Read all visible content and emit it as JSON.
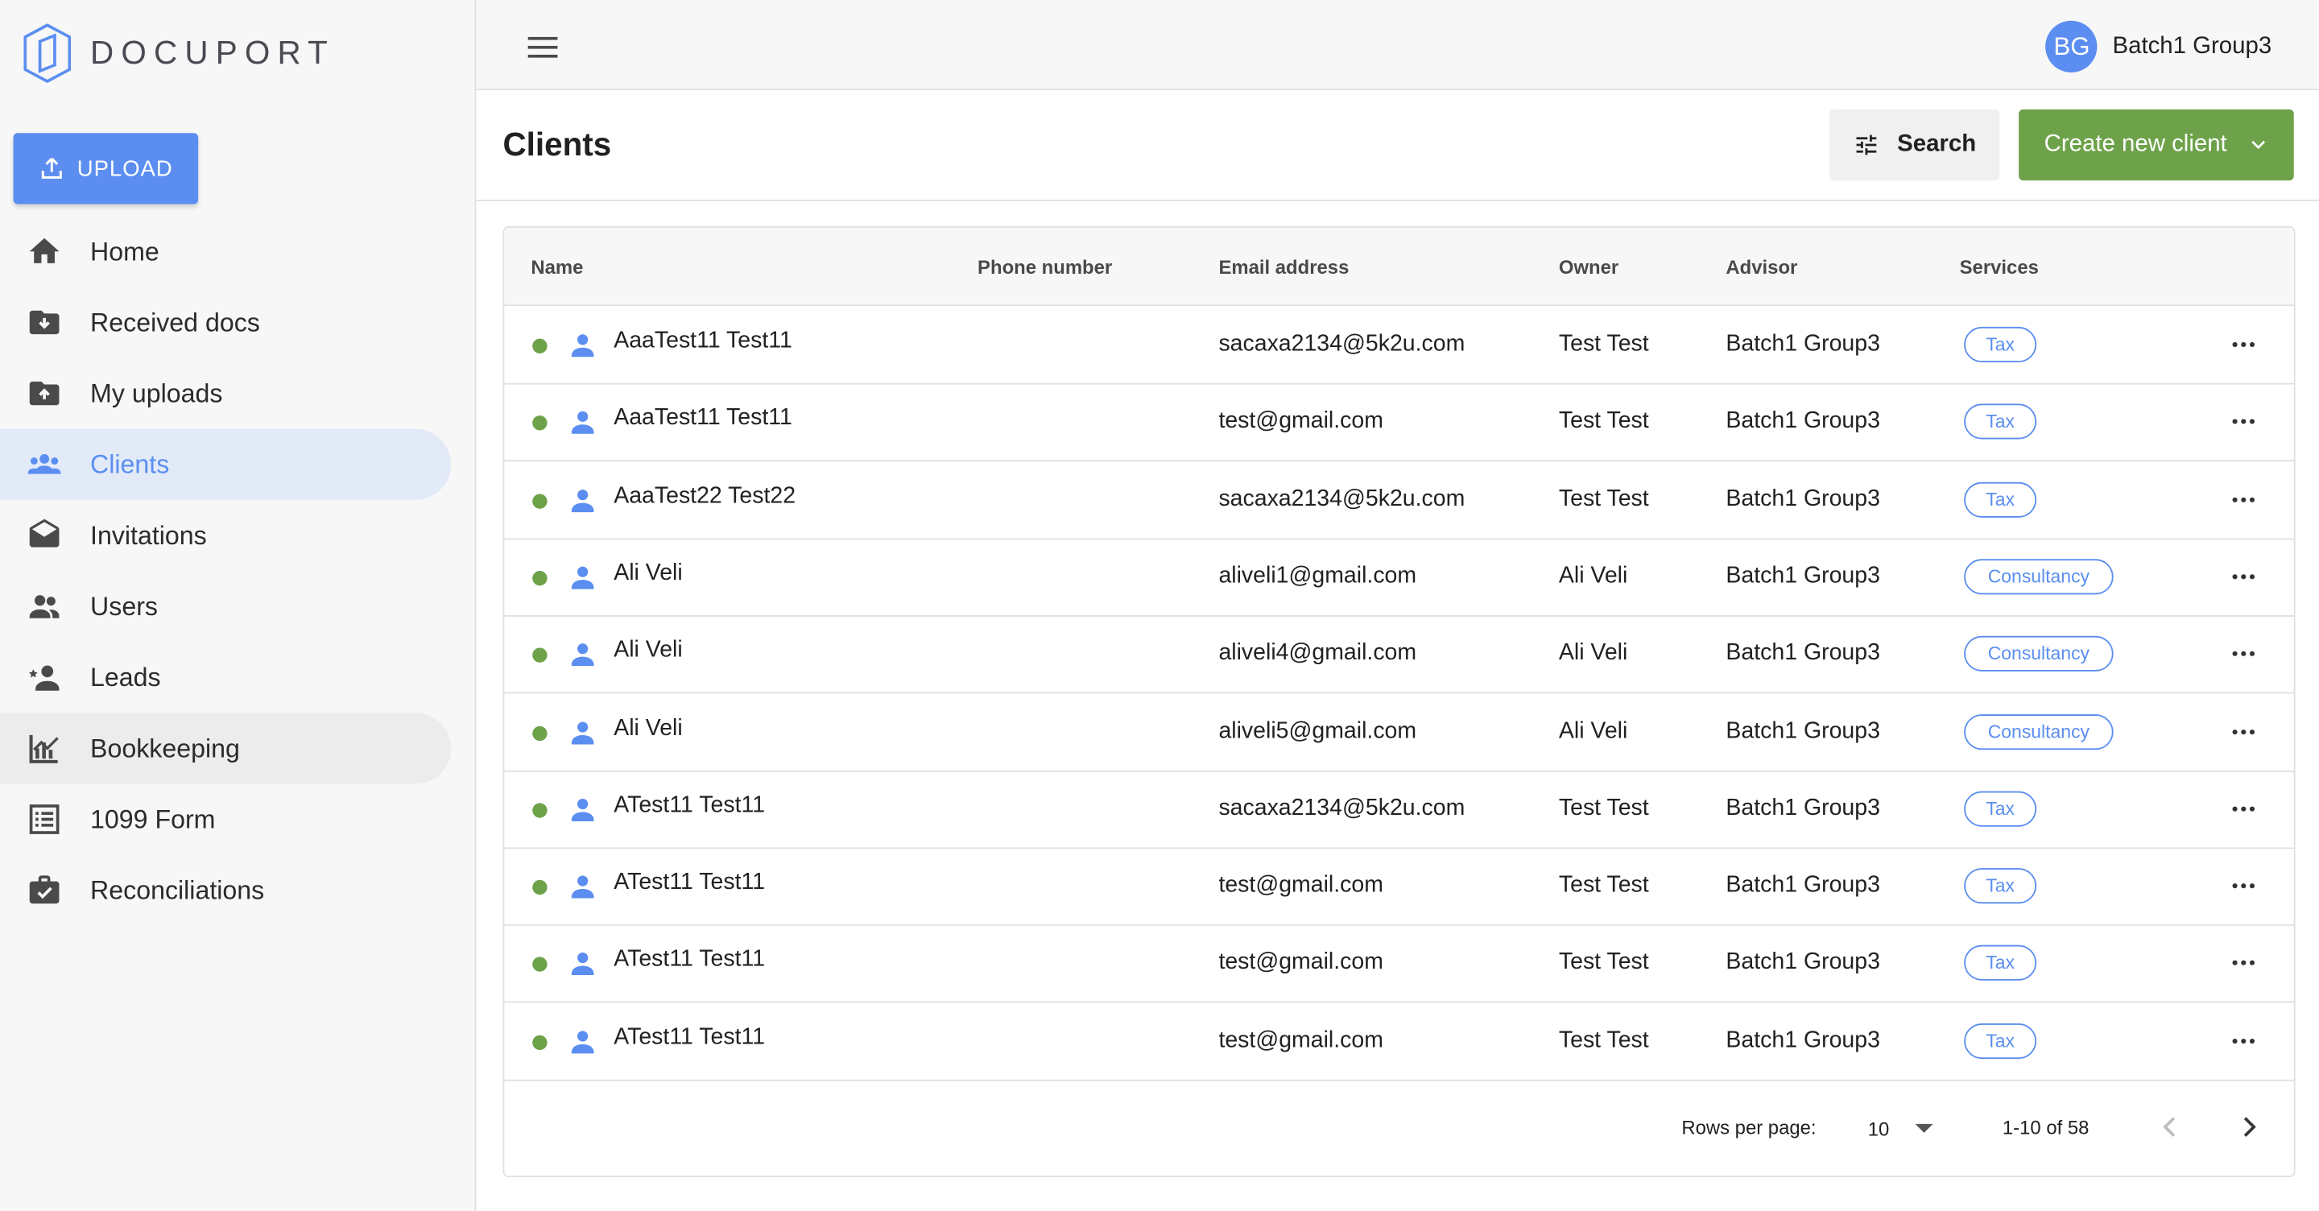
{
  "app": {
    "logo_text": "DOCUPORT"
  },
  "sidebar": {
    "upload_label": "UPLOAD",
    "items": [
      {
        "label": "Home",
        "icon": "home-icon"
      },
      {
        "label": "Received docs",
        "icon": "folder-download-icon"
      },
      {
        "label": "My uploads",
        "icon": "folder-upload-icon"
      },
      {
        "label": "Clients",
        "icon": "people-icon",
        "state": "active"
      },
      {
        "label": "Invitations",
        "icon": "envelope-open-icon"
      },
      {
        "label": "Users",
        "icon": "users-icon"
      },
      {
        "label": "Leads",
        "icon": "lead-star-icon"
      },
      {
        "label": "Bookkeeping",
        "icon": "chart-icon",
        "state": "hover"
      },
      {
        "label": "1099 Form",
        "icon": "list-form-icon"
      },
      {
        "label": "Reconciliations",
        "icon": "briefcase-check-icon"
      }
    ]
  },
  "topbar": {
    "avatar_initials": "BG",
    "username": "Batch1 Group3"
  },
  "header": {
    "title": "Clients",
    "search_label": "Search",
    "create_label": "Create new client"
  },
  "table": {
    "columns": [
      "Name",
      "Phone number",
      "Email address",
      "Owner",
      "Advisor",
      "Services"
    ],
    "rows": [
      {
        "name": "AaaTest11 Test11",
        "phone": "",
        "email": "sacaxa2134@5k2u.com",
        "owner": "Test Test",
        "advisor": "Batch1 Group3",
        "service": "Tax"
      },
      {
        "name": "AaaTest11 Test11",
        "phone": "",
        "email": "test@gmail.com",
        "owner": "Test Test",
        "advisor": "Batch1 Group3",
        "service": "Tax"
      },
      {
        "name": "AaaTest22 Test22",
        "phone": "",
        "email": "sacaxa2134@5k2u.com",
        "owner": "Test Test",
        "advisor": "Batch1 Group3",
        "service": "Tax"
      },
      {
        "name": "Ali Veli",
        "phone": "",
        "email": "aliveli1@gmail.com",
        "owner": "Ali Veli",
        "advisor": "Batch1 Group3",
        "service": "Consultancy"
      },
      {
        "name": "Ali Veli",
        "phone": "",
        "email": "aliveli4@gmail.com",
        "owner": "Ali Veli",
        "advisor": "Batch1 Group3",
        "service": "Consultancy"
      },
      {
        "name": "Ali Veli",
        "phone": "",
        "email": "aliveli5@gmail.com",
        "owner": "Ali Veli",
        "advisor": "Batch1 Group3",
        "service": "Consultancy"
      },
      {
        "name": "ATest11 Test11",
        "phone": "",
        "email": "sacaxa2134@5k2u.com",
        "owner": "Test Test",
        "advisor": "Batch1 Group3",
        "service": "Tax"
      },
      {
        "name": "ATest11 Test11",
        "phone": "",
        "email": "test@gmail.com",
        "owner": "Test Test",
        "advisor": "Batch1 Group3",
        "service": "Tax"
      },
      {
        "name": "ATest11 Test11",
        "phone": "",
        "email": "test@gmail.com",
        "owner": "Test Test",
        "advisor": "Batch1 Group3",
        "service": "Tax"
      },
      {
        "name": "ATest11 Test11",
        "phone": "",
        "email": "test@gmail.com",
        "owner": "Test Test",
        "advisor": "Batch1 Group3",
        "service": "Tax"
      }
    ]
  },
  "pagination": {
    "rows_per_page_label": "Rows per page:",
    "rows_per_page": "10",
    "range": "1-10 of 58"
  },
  "colors": {
    "accent": "#5b8ef0",
    "success": "#6ea24a",
    "active_bg": "#e2eaf8"
  }
}
